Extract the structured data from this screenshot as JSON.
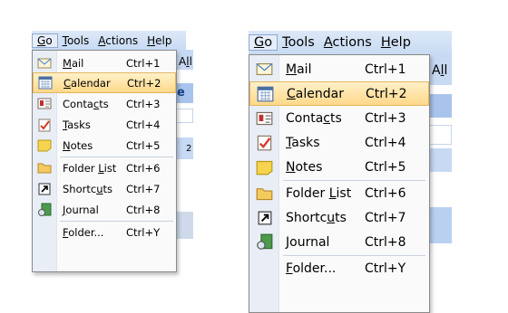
{
  "menubar": {
    "items": [
      {
        "label": "Go",
        "underline": "G",
        "rest": "o"
      },
      {
        "label": "Tools",
        "underline": "T",
        "rest": "ools"
      },
      {
        "label": "Actions",
        "underline": "A",
        "rest": "ctions"
      },
      {
        "label": "Help",
        "underline": "H",
        "rest": "elp"
      }
    ],
    "behind_text": "All",
    "behind_text_left": "A",
    "behind_text_right": "l"
  },
  "go_menu": {
    "items": [
      {
        "pre": "",
        "u": "M",
        "post": "ail",
        "shortcut": "Ctrl+1",
        "icon": "mail-icon",
        "highlighted": false
      },
      {
        "pre": "",
        "u": "C",
        "post": "alendar",
        "shortcut": "Ctrl+2",
        "icon": "calendar-icon",
        "highlighted": true
      },
      {
        "pre": "Conta",
        "u": "c",
        "post": "ts",
        "shortcut": "Ctrl+3",
        "icon": "contacts-icon",
        "highlighted": false
      },
      {
        "pre": "",
        "u": "T",
        "post": "asks",
        "shortcut": "Ctrl+4",
        "icon": "tasks-icon",
        "highlighted": false
      },
      {
        "pre": "",
        "u": "N",
        "post": "otes",
        "shortcut": "Ctrl+5",
        "icon": "notes-icon",
        "highlighted": false
      },
      {
        "pre": "Folder ",
        "u": "L",
        "post": "ist",
        "shortcut": "Ctrl+6",
        "icon": "folder-icon",
        "highlighted": false
      },
      {
        "pre": "Shortc",
        "u": "u",
        "post": "ts",
        "shortcut": "Ctrl+7",
        "icon": "shortcut-icon",
        "highlighted": false
      },
      {
        "pre": "",
        "u": "J",
        "post": "ournal",
        "shortcut": "Ctrl+8",
        "icon": "journal-icon",
        "highlighted": false
      },
      {
        "pre": "",
        "u": "F",
        "post": "older...",
        "shortcut": "Ctrl+Y",
        "icon": "",
        "highlighted": false
      }
    ]
  },
  "colors": {
    "highlight_top": "#fff1c8",
    "highlight_bottom": "#ffd88a",
    "menubar": "#c8dbf3",
    "gutter": "#e9eef6"
  }
}
